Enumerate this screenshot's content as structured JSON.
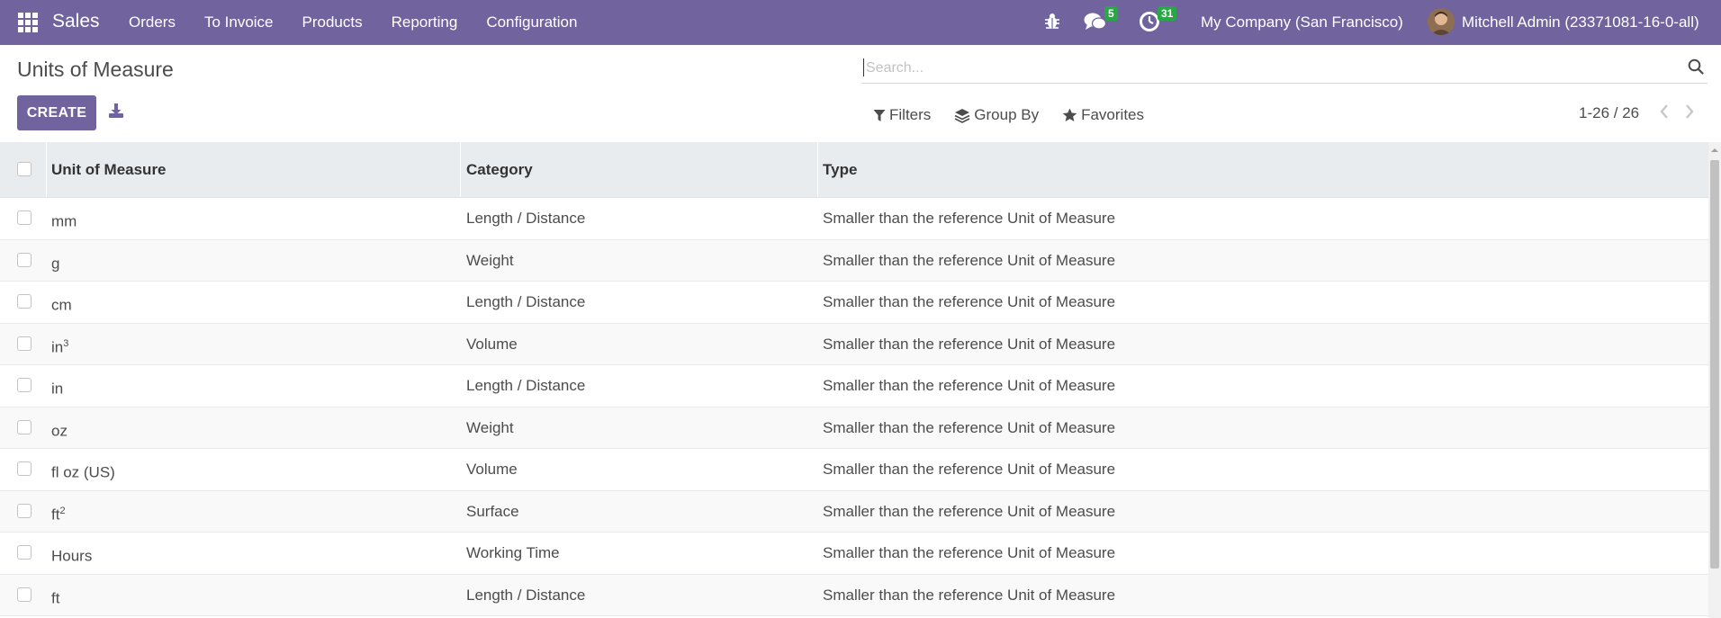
{
  "navbar": {
    "app_name": "Sales",
    "menu": [
      "Orders",
      "To Invoice",
      "Products",
      "Reporting",
      "Configuration"
    ],
    "messages_count": "5",
    "activities_count": "31",
    "company": "My Company (San Francisco)",
    "user": "Mitchell Admin (23371081-16-0-all)",
    "color": "#71639e"
  },
  "control_panel": {
    "title": "Units of Measure",
    "create_label": "CREATE",
    "search_placeholder": "Search...",
    "filters_label": "Filters",
    "group_by_label": "Group By",
    "favorites_label": "Favorites",
    "pager": "1-26 / 26"
  },
  "table": {
    "columns": [
      "Unit of Measure",
      "Category",
      "Type"
    ],
    "rows": [
      {
        "uom": "mm",
        "sup": "",
        "category": "Length / Distance",
        "type": "Smaller than the reference Unit of Measure"
      },
      {
        "uom": "g",
        "sup": "",
        "category": "Weight",
        "type": "Smaller than the reference Unit of Measure"
      },
      {
        "uom": "cm",
        "sup": "",
        "category": "Length / Distance",
        "type": "Smaller than the reference Unit of Measure"
      },
      {
        "uom": "in",
        "sup": "3",
        "category": "Volume",
        "type": "Smaller than the reference Unit of Measure"
      },
      {
        "uom": "in",
        "sup": "",
        "category": "Length / Distance",
        "type": "Smaller than the reference Unit of Measure"
      },
      {
        "uom": "oz",
        "sup": "",
        "category": "Weight",
        "type": "Smaller than the reference Unit of Measure"
      },
      {
        "uom": "fl oz (US)",
        "sup": "",
        "category": "Volume",
        "type": "Smaller than the reference Unit of Measure"
      },
      {
        "uom": "ft",
        "sup": "2",
        "category": "Surface",
        "type": "Smaller than the reference Unit of Measure"
      },
      {
        "uom": "Hours",
        "sup": "",
        "category": "Working Time",
        "type": "Smaller than the reference Unit of Measure"
      },
      {
        "uom": "ft",
        "sup": "",
        "category": "Length / Distance",
        "type": "Smaller than the reference Unit of Measure"
      }
    ]
  },
  "icons": [
    "apps-icon",
    "bug-icon",
    "chat-icon",
    "clock-icon",
    "download-icon",
    "search-icon",
    "filter-icon",
    "layers-icon",
    "star-icon",
    "chevron-left-icon",
    "chevron-right-icon"
  ]
}
